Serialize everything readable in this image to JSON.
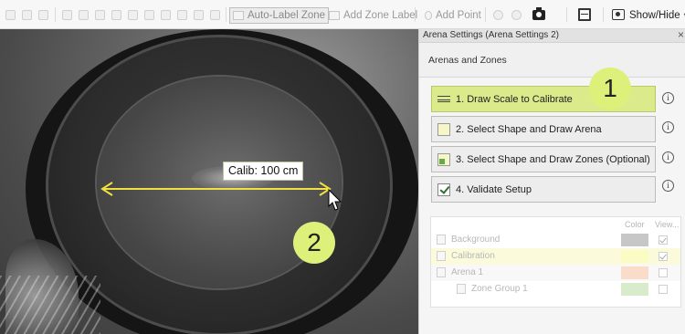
{
  "toolbar": {
    "auto_label_zone": "Auto-Label Zone",
    "add_zone_label": "Add Zone Label",
    "add_point": "Add Point",
    "show_hide": "Show/Hide"
  },
  "video": {
    "calibration_label": "Calib: 100 cm",
    "callout_2": "2"
  },
  "panel": {
    "title": "Arena Settings (Arena Settings 2)",
    "close": "×",
    "section": "Arenas and Zones",
    "callout_1": "1",
    "steps": [
      {
        "label": "1. Draw Scale to Calibrate",
        "info": "i"
      },
      {
        "label": "2. Select Shape and Draw Arena",
        "info": "i"
      },
      {
        "label": "3. Select Shape and Draw Zones (Optional)",
        "info": "i"
      },
      {
        "label": "4.  Validate Setup",
        "info": "i"
      }
    ],
    "columns": {
      "color": "Color",
      "view": "View..."
    },
    "items": [
      {
        "label": "Background",
        "color": "#c7c7c7",
        "visible": true
      },
      {
        "label": "Calibration",
        "color": "#fbfbc4",
        "visible": true
      },
      {
        "label": "Arena 1",
        "color": "#f9dcc9",
        "visible": false
      },
      {
        "label": "Zone Group 1",
        "color": "#d8eccb",
        "visible": false
      }
    ]
  },
  "colors": {
    "active_step": "#dbea8a",
    "callout": "#dcf07a",
    "calibration_line": "#f0e040"
  }
}
